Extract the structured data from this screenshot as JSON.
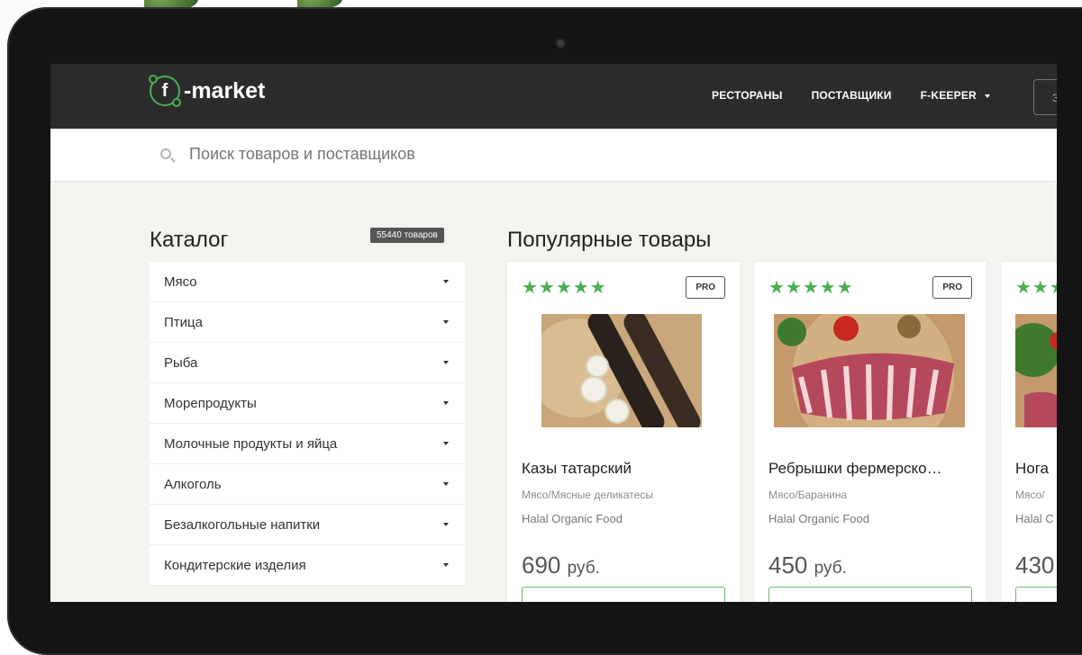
{
  "nav": {
    "logo_letter": "f",
    "logo_text": "-market",
    "links": [
      "РЕСТОРАНЫ",
      "ПОСТАВЩИКИ",
      "F-KEEPER"
    ],
    "button_label": "З"
  },
  "search": {
    "placeholder": "Поиск товаров и поставщиков"
  },
  "catalog": {
    "title": "Каталог",
    "count": "55440 товаров",
    "items": [
      "Мясо",
      "Птица",
      "Рыба",
      "Морепродукты",
      "Молочные продукты и яйца",
      "Алкоголь",
      "Безалкогольные напитки",
      "Кондитерские изделия"
    ]
  },
  "popular": {
    "title": "Популярные товары",
    "cards": [
      {
        "stars": "★★★★★",
        "badge": "PRO",
        "name": "Казы татарский",
        "category": "Мясо/Мясные деликатесы",
        "supplier": "Halal Organic Food",
        "price": "690",
        "currency": "руб."
      },
      {
        "stars": "★★★★★",
        "badge": "PRO",
        "name": "Ребрышки фермерско…",
        "category": "Мясо/Баранина",
        "supplier": "Halal Organic Food",
        "price": "450",
        "currency": "руб."
      },
      {
        "stars": "★★★",
        "name": "Нога",
        "category": "Мясо/",
        "supplier": "Halal C",
        "price": "430"
      }
    ]
  },
  "colors": {
    "accent": "#4caf50",
    "nav_bg": "#2b2b2b",
    "page_bg": "#f4f3ef"
  }
}
